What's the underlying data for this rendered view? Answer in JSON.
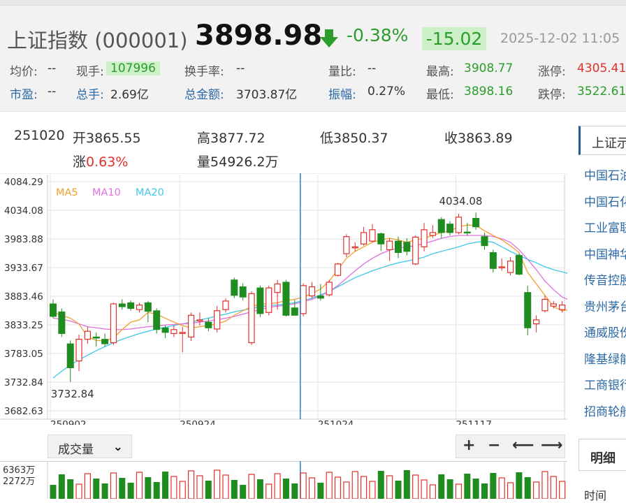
{
  "header": {
    "title": "上证指数 (000001)",
    "price": "3898.98",
    "change_pct": "-0.38%",
    "change_value": "-15.02",
    "datetime": "2025-12-02 11:05",
    "stats": [
      {
        "label": "均价:",
        "value": "--",
        "label_color": "gray",
        "value_color": "normal"
      },
      {
        "label": "现手:",
        "value": "107996",
        "label_color": "gray",
        "value_color": "green"
      },
      {
        "label": "换手率:",
        "value": "--",
        "label_color": "gray",
        "value_color": "normal"
      },
      {
        "label": "量比:",
        "value": "--",
        "label_color": "gray",
        "value_color": "normal"
      },
      {
        "label": "最高:",
        "value": "3908.77",
        "label_color": "gray",
        "value_color": "green"
      },
      {
        "label": "涨停:",
        "value": "4305.41",
        "label_color": "gray",
        "value_color": "red"
      },
      {
        "label": "市盈:",
        "value": "--",
        "label_color": "blue",
        "value_color": "normal"
      },
      {
        "label": "总手:",
        "value": "2.69亿",
        "label_color": "blue",
        "value_color": "normal"
      },
      {
        "label": "总金额:",
        "value": "3703.87亿",
        "label_color": "blue",
        "value_color": "normal"
      },
      {
        "label": "振幅:",
        "value": "0.27%",
        "label_color": "blue",
        "value_color": "normal"
      },
      {
        "label": "最低:",
        "value": "3898.16",
        "label_color": "gray",
        "value_color": "green"
      },
      {
        "label": "跌停:",
        "value": "3522.61",
        "label_color": "gray",
        "value_color": "green"
      }
    ]
  },
  "crosshair_info": {
    "date": "251020",
    "open_label": "开",
    "open": "3865.55",
    "high_label": "高",
    "high": "3877.72",
    "low_label": "低",
    "low": "3850.37",
    "close_label": "收",
    "close": "3863.89",
    "change_label": "涨",
    "change": "0.63%",
    "volume_label": "量",
    "volume": "54926.2万"
  },
  "chart_data": {
    "type": "candlestick",
    "ylim": [
      3682.63,
      4084.29
    ],
    "y_ticks": [
      "4084.29",
      "4034.08",
      "3983.88",
      "3933.67",
      "3883.46",
      "3833.25",
      "3783.05",
      "3732.84",
      "3682.63"
    ],
    "x_ticks": [
      {
        "label": "250902",
        "index": 0
      },
      {
        "label": "250924",
        "index": 15
      },
      {
        "label": "251024",
        "index": 31
      },
      {
        "label": "251117",
        "index": 47
      }
    ],
    "legend": [
      {
        "name": "MA5",
        "color": "#f0a030"
      },
      {
        "name": "MA10",
        "color": "#e070e0"
      },
      {
        "name": "MA20",
        "color": "#40c8e8"
      }
    ],
    "annotations": [
      {
        "text": "4034.08",
        "index": 47,
        "value": 4034.08
      },
      {
        "text": "3732.84",
        "index": 2,
        "value": 3732.84
      }
    ],
    "candles": [
      [
        3870,
        3848,
        3878,
        3845
      ],
      [
        3856,
        3818,
        3862,
        3812
      ],
      [
        3800,
        3758,
        3806,
        3733
      ],
      [
        3770,
        3808,
        3816,
        3752
      ],
      [
        3808,
        3822,
        3830,
        3800
      ],
      [
        3812,
        3810,
        3820,
        3795
      ],
      [
        3808,
        3800,
        3818,
        3795
      ],
      [
        3802,
        3870,
        3872,
        3798
      ],
      [
        3870,
        3865,
        3878,
        3860
      ],
      [
        3872,
        3862,
        3876,
        3858
      ],
      [
        3860,
        3868,
        3872,
        3855
      ],
      [
        3872,
        3857,
        3875,
        3838
      ],
      [
        3858,
        3825,
        3862,
        3818
      ],
      [
        3828,
        3820,
        3832,
        3810
      ],
      [
        3818,
        3825,
        3832,
        3812
      ],
      [
        3820,
        3820,
        3830,
        3785
      ],
      [
        3812,
        3850,
        3855,
        3805
      ],
      [
        3840,
        3842,
        3855,
        3832
      ],
      [
        3838,
        3828,
        3845,
        3822
      ],
      [
        3826,
        3858,
        3866,
        3820
      ],
      [
        3860,
        3875,
        3880,
        3855
      ],
      [
        3912,
        3885,
        3916,
        3880
      ],
      [
        3900,
        3882,
        3906,
        3876
      ],
      [
        3802,
        3888,
        3892,
        3798
      ],
      [
        3898,
        3853,
        3902,
        3847
      ],
      [
        3855,
        3898,
        3902,
        3850
      ],
      [
        3890,
        3905,
        3912,
        3860
      ],
      [
        3908,
        3850,
        3912,
        3848
      ],
      [
        3863,
        3850,
        3877,
        3850
      ],
      [
        3853,
        3902,
        3906,
        3848
      ],
      [
        3884,
        3900,
        3908,
        3880
      ],
      [
        3884,
        3880,
        3905,
        3876
      ],
      [
        3886,
        3908,
        3912,
        3883
      ],
      [
        3920,
        3940,
        3942,
        3918
      ],
      [
        3958,
        3988,
        3992,
        3952
      ],
      [
        3970,
        3970,
        3978,
        3962
      ],
      [
        3975,
        3995,
        4005,
        3972
      ],
      [
        3980,
        4000,
        4010,
        3978
      ],
      [
        3993,
        3975,
        3995,
        3963
      ],
      [
        3965,
        3980,
        3985,
        3945
      ],
      [
        3980,
        3960,
        3988,
        3950
      ],
      [
        3978,
        3962,
        3985,
        3955
      ],
      [
        3940,
        3987,
        3990,
        3938
      ],
      [
        3970,
        4000,
        4012,
        3962
      ],
      [
        3990,
        3995,
        4008,
        3986
      ],
      [
        4018,
        3995,
        4022,
        3985
      ],
      [
        4010,
        3995,
        4015,
        3990
      ],
      [
        3995,
        4022,
        4028,
        3992
      ],
      [
        3996,
        3995,
        4012,
        3990
      ],
      [
        4020,
        4005,
        4030,
        4000
      ],
      [
        3988,
        3972,
        3995,
        3965
      ],
      [
        3960,
        3932,
        3965,
        3925
      ],
      [
        3935,
        3935,
        3950,
        3928
      ],
      [
        3925,
        3945,
        3952,
        3920
      ],
      [
        3955,
        3922,
        3958,
        3920
      ],
      [
        3890,
        3828,
        3902,
        3815
      ],
      [
        3835,
        3842,
        3850,
        3820
      ],
      [
        3858,
        3878,
        3885,
        3855
      ],
      [
        3866,
        3870,
        3875,
        3862
      ],
      [
        3860,
        3868,
        3875,
        3855
      ],
      [
        3870,
        3878,
        3888,
        3862
      ],
      [
        3883,
        3888,
        3895,
        3882
      ],
      [
        3912,
        3905,
        3916,
        3898
      ],
      [
        3892,
        3862,
        3894,
        3858
      ],
      [
        3852,
        3836,
        3856,
        3833
      ]
    ],
    "ma5": [
      3855,
      3850,
      3845,
      3835,
      3812,
      3806,
      3805,
      3810,
      3825,
      3838,
      3842,
      3855,
      3852,
      3845,
      3838,
      3832,
      3828,
      3830,
      3832,
      3835,
      3840,
      3850,
      3858,
      3865,
      3870,
      3870,
      3872,
      3876,
      3878,
      3882,
      3888,
      3896,
      3910,
      3930,
      3950,
      3962,
      3970,
      3978,
      3982,
      3985,
      3982,
      3978,
      3982,
      3985,
      3990,
      3995,
      3998,
      4005,
      4008,
      4008,
      3998,
      3990,
      3982,
      3972,
      3960,
      3925,
      3905,
      3885,
      3865,
      3858,
      3860,
      3862,
      3868,
      3870,
      3872
    ],
    "ma10": [
      3845,
      3843,
      3840,
      3835,
      3830,
      3828,
      3826,
      3825,
      3825,
      3826,
      3828,
      3830,
      3831,
      3833,
      3834,
      3835,
      3836,
      3838,
      3840,
      3842,
      3845,
      3848,
      3852,
      3856,
      3860,
      3864,
      3866,
      3868,
      3870,
      3874,
      3878,
      3884,
      3892,
      3902,
      3915,
      3928,
      3940,
      3950,
      3958,
      3964,
      3968,
      3970,
      3972,
      3976,
      3980,
      3985,
      3988,
      3990,
      3990,
      3990,
      3990,
      3988,
      3984,
      3978,
      3965,
      3948,
      3930,
      3910,
      3895,
      3882,
      3875,
      3872,
      3872,
      3872,
      3872
    ],
    "ma20": [
      3740,
      3752,
      3763,
      3772,
      3780,
      3788,
      3795,
      3802,
      3808,
      3813,
      3818,
      3822,
      3826,
      3829,
      3832,
      3835,
      3838,
      3842,
      3845,
      3849,
      3852,
      3856,
      3859,
      3862,
      3865,
      3867,
      3868,
      3870,
      3872,
      3876,
      3880,
      3886,
      3892,
      3900,
      3908,
      3916,
      3922,
      3928,
      3933,
      3938,
      3942,
      3945,
      3948,
      3952,
      3958,
      3962,
      3966,
      3970,
      3975,
      3978,
      3980,
      3978,
      3970,
      3962,
      3955,
      3948,
      3942,
      3935,
      3930,
      3926,
      3922,
      3918,
      3915,
      3912,
      3910
    ]
  },
  "toolbar": {
    "indicator_select": "成交量",
    "zoom_in": "+",
    "zoom_out": "−",
    "pan_left": "⟵",
    "pan_right": "⟶"
  },
  "volume_axis": {
    "labels": [
      "6363万",
      "2272万"
    ]
  },
  "right_panel": {
    "tab": "上证示",
    "items": [
      "中国石油",
      "中国石化",
      "工业富联",
      "中国神华",
      "传音控股",
      "贵州茅台",
      "通威股份",
      "隆基绿能",
      "工商银行",
      "招商轮船"
    ],
    "detail_tab": "明细",
    "time_label": "时间"
  }
}
